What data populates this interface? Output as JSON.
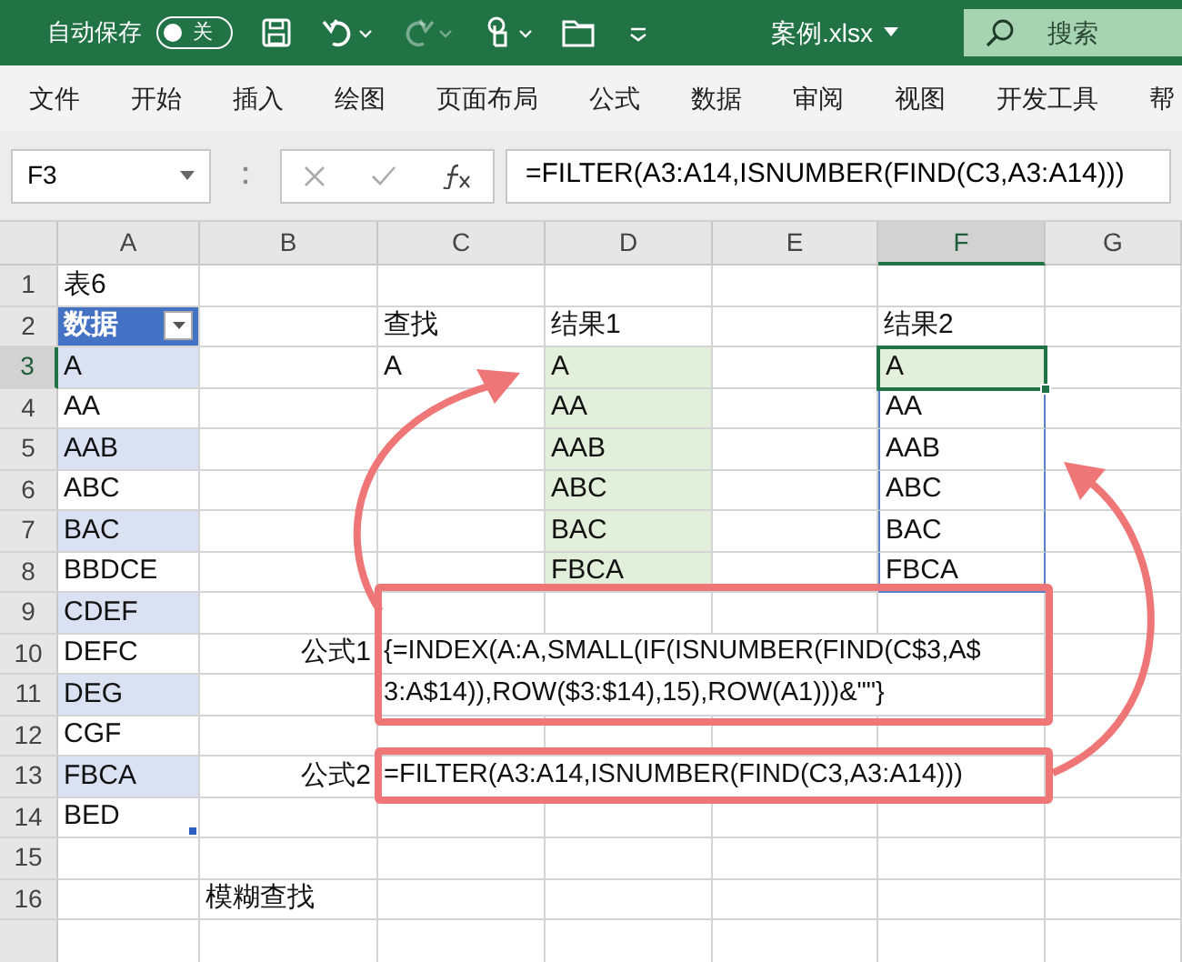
{
  "title_bar": {
    "autosave": {
      "label": "自动保存",
      "on": false,
      "state_label": "关"
    },
    "quick_access": [
      {
        "kind": "save",
        "disabled": false
      },
      {
        "kind": "undo",
        "disabled": false
      },
      {
        "kind": "redo",
        "disabled": true
      },
      {
        "kind": "touch",
        "disabled": false
      },
      {
        "kind": "folder",
        "disabled": false
      },
      {
        "kind": "customize",
        "disabled": false
      }
    ],
    "file_name": "案例.xlsx",
    "search": {
      "placeholder": "搜索"
    }
  },
  "ribbon_tabs": [
    "文件",
    "开始",
    "插入",
    "绘图",
    "页面布局",
    "公式",
    "数据",
    "审阅",
    "视图",
    "开发工具",
    "帮"
  ],
  "formula_bar": {
    "name_box": "F3",
    "formula": "=FILTER(A3:A14,ISNUMBER(FIND(C3,A3:A14)))"
  },
  "sheet": {
    "columns": [
      {
        "label": "A",
        "selected": false
      },
      {
        "label": "B",
        "selected": false
      },
      {
        "label": "C",
        "selected": false
      },
      {
        "label": "D",
        "selected": false
      },
      {
        "label": "E",
        "selected": false
      },
      {
        "label": "F",
        "selected": true
      },
      {
        "label": "G",
        "selected": false
      }
    ],
    "rows": [
      {
        "number": "1",
        "selected": false,
        "cells": [
          {
            "text": "表6"
          },
          null,
          null,
          null,
          null,
          null,
          null
        ]
      },
      {
        "number": "2",
        "selected": false,
        "cells": [
          {
            "text": "数据",
            "color": "#4472c4",
            "filter": true
          },
          null,
          {
            "text": "查找"
          },
          {
            "text": "结果1"
          },
          null,
          {
            "text": "结果2"
          },
          null
        ]
      },
      {
        "number": "3",
        "selected": true,
        "cells": [
          {
            "text": "A",
            "color": "#d9e1f2"
          },
          null,
          {
            "text": "A"
          },
          {
            "text": "A",
            "color": "#e2efda"
          },
          null,
          {
            "text": "A",
            "color": "#e2efda",
            "active": true,
            "spill": true
          },
          null
        ]
      },
      {
        "number": "4",
        "selected": false,
        "cells": [
          {
            "text": "AA"
          },
          null,
          null,
          {
            "text": "AA",
            "color": "#e2efda"
          },
          null,
          {
            "text": "AA",
            "spill": true
          },
          null
        ]
      },
      {
        "number": "5",
        "selected": false,
        "cells": [
          {
            "text": "AAB",
            "color": "#d9e1f2"
          },
          null,
          null,
          {
            "text": "AAB",
            "color": "#e2efda"
          },
          null,
          {
            "text": "AAB",
            "spill": true
          },
          null
        ]
      },
      {
        "number": "6",
        "selected": false,
        "cells": [
          {
            "text": "ABC"
          },
          null,
          null,
          {
            "text": "ABC",
            "color": "#e2efda"
          },
          null,
          {
            "text": "ABC",
            "spill": true
          },
          null
        ]
      },
      {
        "number": "7",
        "selected": false,
        "cells": [
          {
            "text": "BAC",
            "color": "#d9e1f2"
          },
          null,
          null,
          {
            "text": "BAC",
            "color": "#e2efda"
          },
          null,
          {
            "text": "BAC",
            "spill": true
          },
          null
        ]
      },
      {
        "number": "8",
        "selected": false,
        "cells": [
          {
            "text": "BBDCE"
          },
          null,
          null,
          {
            "text": "FBCA",
            "color": "#e2efda"
          },
          null,
          {
            "text": "FBCA",
            "spill": true
          },
          null
        ]
      },
      {
        "number": "9",
        "selected": false,
        "cells": [
          {
            "text": "CDEF",
            "color": "#d9e1f2"
          },
          null,
          null,
          null,
          null,
          null,
          null
        ]
      },
      {
        "number": "10",
        "selected": false,
        "cells": [
          {
            "text": "DEFC"
          },
          {
            "text": "公式1",
            "kind": "label"
          },
          {
            "text": "{=INDEX(A:A,SMALL(IF(ISNUMBER(FIND(C$3,A$"
          },
          null,
          null,
          null,
          null
        ]
      },
      {
        "number": "11",
        "selected": false,
        "cells": [
          {
            "text": "DEG",
            "color": "#d9e1f2"
          },
          null,
          {
            "text": "3:A$14)),ROW($3:$14),15),ROW(A1)))&\"\"}"
          },
          null,
          null,
          null,
          null
        ]
      },
      {
        "number": "12",
        "selected": false,
        "cells": [
          {
            "text": "CGF"
          },
          null,
          null,
          null,
          null,
          null,
          null
        ]
      },
      {
        "number": "13",
        "selected": false,
        "cells": [
          {
            "text": "FBCA",
            "color": "#d9e1f2"
          },
          {
            "text": "公式2",
            "kind": "label"
          },
          {
            "text": "=FILTER(A3:A14,ISNUMBER(FIND(C3,A3:A14)))"
          },
          null,
          null,
          null,
          null
        ]
      },
      {
        "number": "14",
        "selected": false,
        "cells": [
          {
            "text": "BED",
            "resize_handle": true
          },
          null,
          null,
          null,
          null,
          null,
          null
        ]
      },
      {
        "number": "15",
        "selected": false,
        "cells": [
          null,
          null,
          null,
          null,
          null,
          null,
          null
        ]
      },
      {
        "number": "16",
        "selected": false,
        "cells": [
          null,
          {
            "text": "模糊查找"
          },
          null,
          null,
          null,
          null,
          null
        ]
      }
    ]
  }
}
